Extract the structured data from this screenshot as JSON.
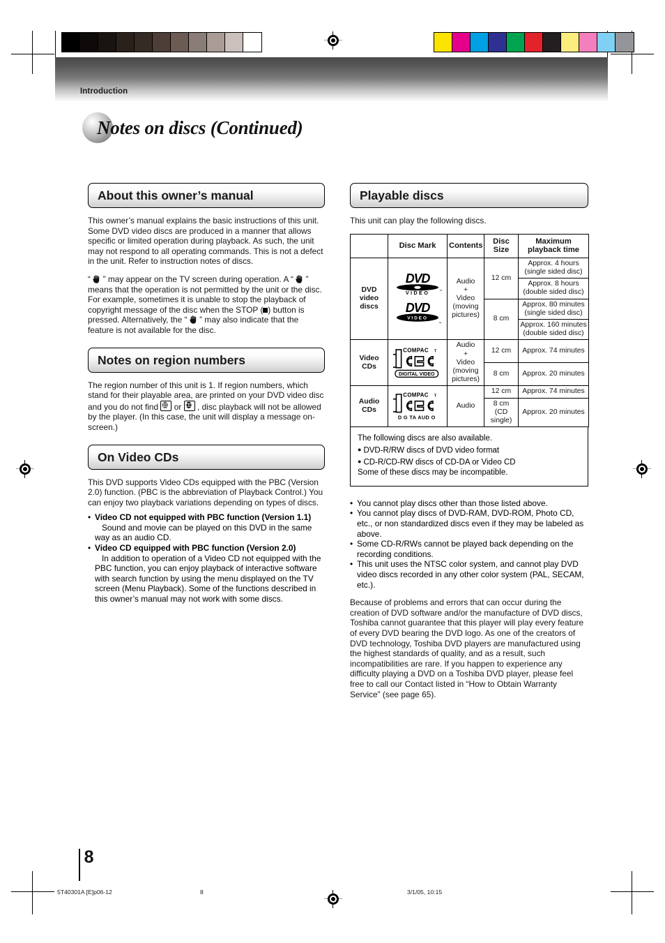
{
  "header": {
    "section_label": "Introduction",
    "page_title": "Notes on discs (Continued)"
  },
  "left_column": {
    "about_manual": {
      "heading": "About this owner’s manual",
      "paragraph_1": "This owner’s manual explains the basic instructions of this unit. Some DVD video discs are produced in a manner that allows specific or limited operation during playback. As such, the unit may not respond to all operating commands. This is not a defect in the unit. Refer to instruction notes of discs.",
      "para2_a": "“",
      "para2_b": "” may appear on the TV screen during operation. A “",
      "para2_c": "” means that the operation is not permitted by the unit or the disc.",
      "para3_a": "For example, sometimes it is unable to stop the playback of copyright message of the disc when the STOP (",
      "para3_b": ") button is pressed. Alternatively, the “",
      "para3_c": "” may also indicate that the feature is not available for the disc."
    },
    "region_numbers": {
      "heading": "Notes on region numbers",
      "text_a": "The region number of this unit is 1. If region numbers, which stand for their playable area, are printed on your DVD video disc and you do not find",
      "text_b": "or",
      "text_c": ", disc playback will not be allowed by the player. (In this case, the unit will display a message on-screen.)"
    },
    "video_cds": {
      "heading": "On Video CDs",
      "intro": "This DVD supports Video CDs equipped with the PBC (Version 2.0) function. (PBC is the abbreviation of Playback Control.) You can enjoy two playback variations depending on types of discs.",
      "bullets": [
        {
          "title": "Video CD not equipped with PBC function (Version 1.1)",
          "body": "Sound and movie can be played on this DVD in the same way as an audio CD."
        },
        {
          "title": "Video CD equipped with PBC function (Version 2.0)",
          "body": "In addition to operation of a Video CD not equipped with the PBC function, you can enjoy playback of interactive software with search function by using the menu displayed on the TV screen (Menu Playback). Some of the functions described in this owner’s manual may not work with some discs."
        }
      ]
    }
  },
  "right_column": {
    "playable_discs": {
      "heading": "Playable discs",
      "intro": "This unit can play the following discs.",
      "table": {
        "headers": [
          "",
          "Disc Mark",
          "Contents",
          "Disc Size",
          "Maximum playback time"
        ],
        "rows": [
          {
            "category": "DVD video discs",
            "disc_mark": [
              "dvd-video-logo",
              "dvd-video-logo-filled"
            ],
            "contents": "Audio + Video (moving pictures)",
            "sizes": [
              {
                "size": "12 cm",
                "times": [
                  {
                    "main": "Approx. 4 hours",
                    "sub": "(single sided disc)"
                  },
                  {
                    "main": "Approx. 8 hours",
                    "sub": "(double sided disc)"
                  }
                ]
              },
              {
                "size": "8 cm",
                "times": [
                  {
                    "main": "Approx. 80 minutes",
                    "sub": "(single sided disc)"
                  },
                  {
                    "main": "Approx. 160 minutes",
                    "sub": "(double sided disc)"
                  }
                ]
              }
            ]
          },
          {
            "category": "Video CDs",
            "disc_mark": [
              "compact-disc-digital-video-logo"
            ],
            "contents": "Audio + Video (moving pictures)",
            "sizes": [
              {
                "size": "12 cm",
                "times": [
                  {
                    "main": "Approx. 74 minutes",
                    "sub": ""
                  }
                ]
              },
              {
                "size": "8 cm",
                "times": [
                  {
                    "main": "Approx. 20 minutes",
                    "sub": ""
                  }
                ]
              }
            ]
          },
          {
            "category": "Audio CDs",
            "disc_mark": [
              "compact-disc-digital-audio-logo"
            ],
            "contents": "Audio",
            "sizes": [
              {
                "size": "12 cm",
                "times": [
                  {
                    "main": "Approx. 74 minutes",
                    "sub": ""
                  }
                ]
              },
              {
                "size": "8 cm (CD single)",
                "times": [
                  {
                    "main": "Approx. 20 minutes",
                    "sub": ""
                  }
                ]
              }
            ]
          }
        ]
      },
      "notebox": {
        "line1": "The following discs are also available.",
        "bullet1": "DVD-R/RW discs of DVD video format",
        "bullet2": "CD-R/CD-RW discs of CD-DA or Video CD",
        "line2": "Some of these discs may be incompatible."
      },
      "cautions": [
        "You cannot play discs other than those listed above.",
        "You cannot play discs of DVD-RAM, DVD-ROM, Photo CD, etc., or non standardized discs even if they may be labeled as above.",
        "Some CD-R/RWs cannot be played back depending on the recording conditions.",
        "This unit uses the NTSC color system, and cannot play DVD video discs recorded in any other color system (PAL, SECAM, etc.)."
      ],
      "closing_paragraph": "Because of problems and errors that can occur during the creation of DVD software and/or the manufacture of DVD discs, Toshiba cannot guarantee that this player will play every feature of every DVD bearing the DVD logo.  As one of the creators of DVD technology, Toshiba DVD players are manufactured using the highest standards of quality, and as a result, such incompatibilities are rare.  If you happen to experience any difficulty playing a DVD on a Toshiba DVD player, please feel free to call our Contact listed in “How to Obtain Warranty Service” (see page 65)."
    }
  },
  "page_number": "8",
  "footer": {
    "file_ref": "5T40301A [E]p06-12",
    "page": "8",
    "timestamp": "3/1/05, 10:15"
  },
  "color_bars": {
    "grayscale": [
      "#000000",
      "#0d0a09",
      "#19140f",
      "#2a211b",
      "#362b24",
      "#4d3f37",
      "#6b5b53",
      "#8a7c76",
      "#a99c97",
      "#cbc0bc",
      "#ffffff"
    ],
    "chromatic": [
      "#fbe500",
      "#e5008c",
      "#00a0e4",
      "#2e3192",
      "#00a34f",
      "#e3232b",
      "#231f20",
      "#fced7f",
      "#f47fbe",
      "#7fd0f2",
      "#939598"
    ]
  }
}
